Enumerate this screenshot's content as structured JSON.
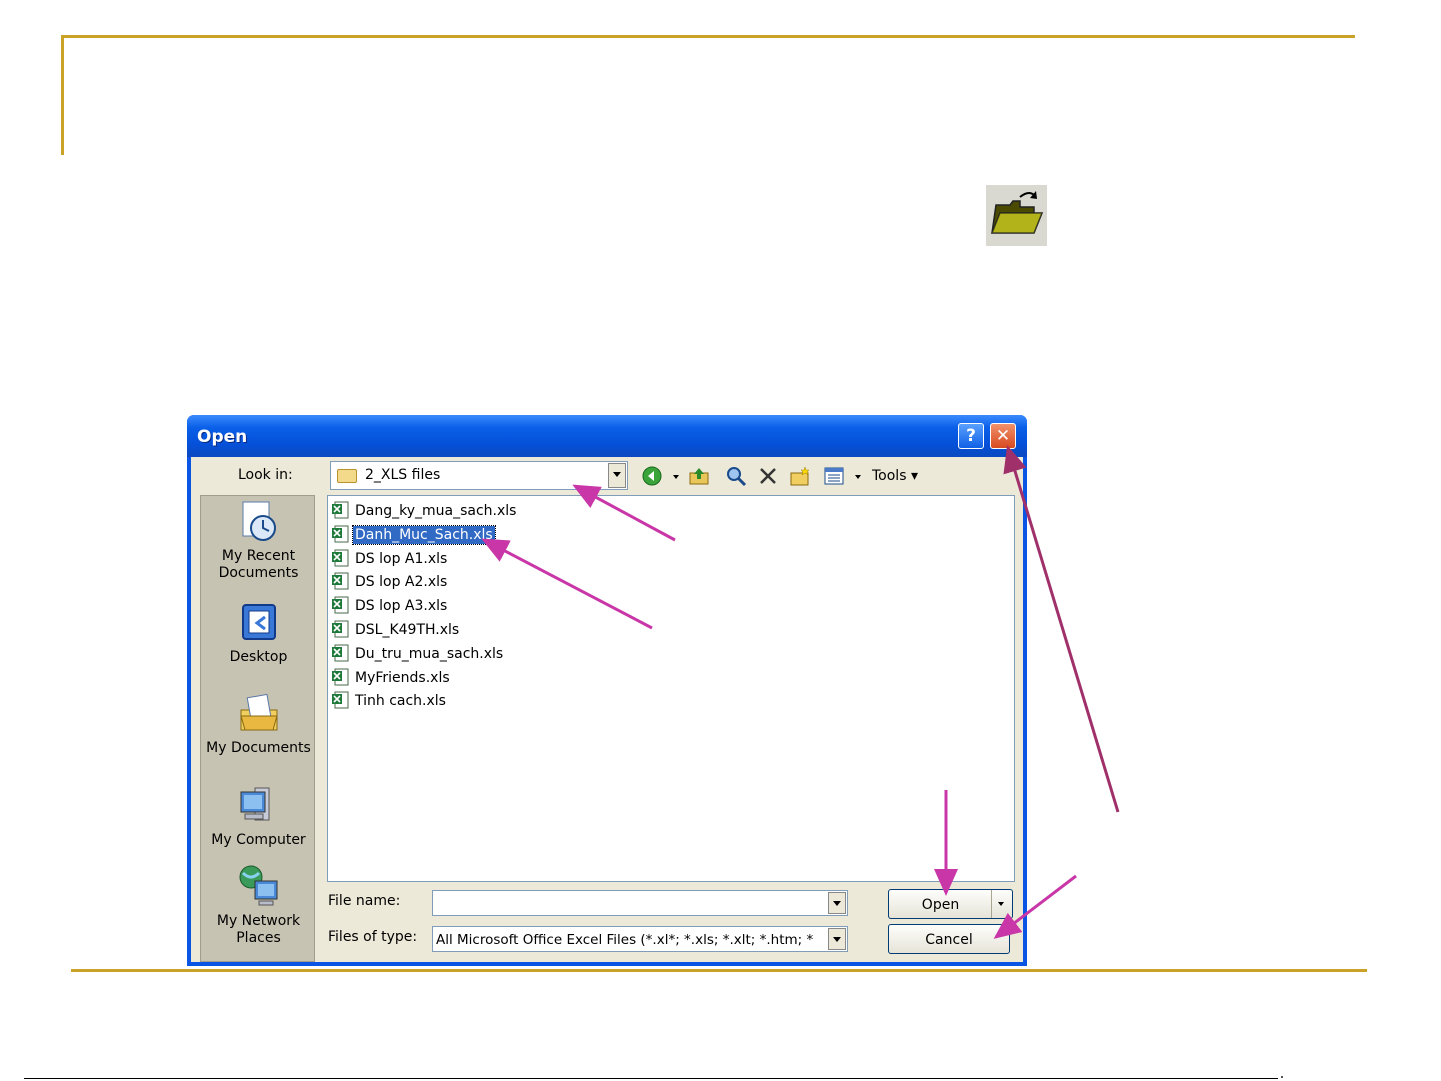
{
  "dialog": {
    "title": "Open",
    "help_label": "?",
    "close_label": "✕",
    "look_in_label": "Look in:",
    "look_in_value": "2_XLS files",
    "tools_label": "Tools",
    "places": [
      {
        "label": "My Recent Documents"
      },
      {
        "label": "Desktop"
      },
      {
        "label": "My Documents"
      },
      {
        "label": "My Computer"
      },
      {
        "label": "My Network Places"
      }
    ],
    "files": [
      "Dang_ky_mua_sach.xls",
      "Danh_Muc_Sach.xls",
      "DS lop A1.xls",
      "DS lop A2.xls",
      "DS lop A3.xls",
      "DSL_K49TH.xls",
      "Du_tru_mua_sach.xls",
      "MyFriends.xls",
      "Tinh cach.xls"
    ],
    "selected_file": "Danh_Muc_Sach.xls",
    "file_name_label": "File name:",
    "file_name_value": "",
    "file_type_label": "Files of type:",
    "file_type_value": "All Microsoft Office Excel Files (*.xl*; *.xls; *.xlt; *.htm; *",
    "open_label": "Open",
    "cancel_label": "Cancel"
  },
  "colors": {
    "accent_gold": "#c9a227",
    "annotation_magenta": "#c936a8",
    "annotation_maroon": "#a0306a",
    "selection": "#316ac5",
    "titlebar": "#0a55e3"
  }
}
